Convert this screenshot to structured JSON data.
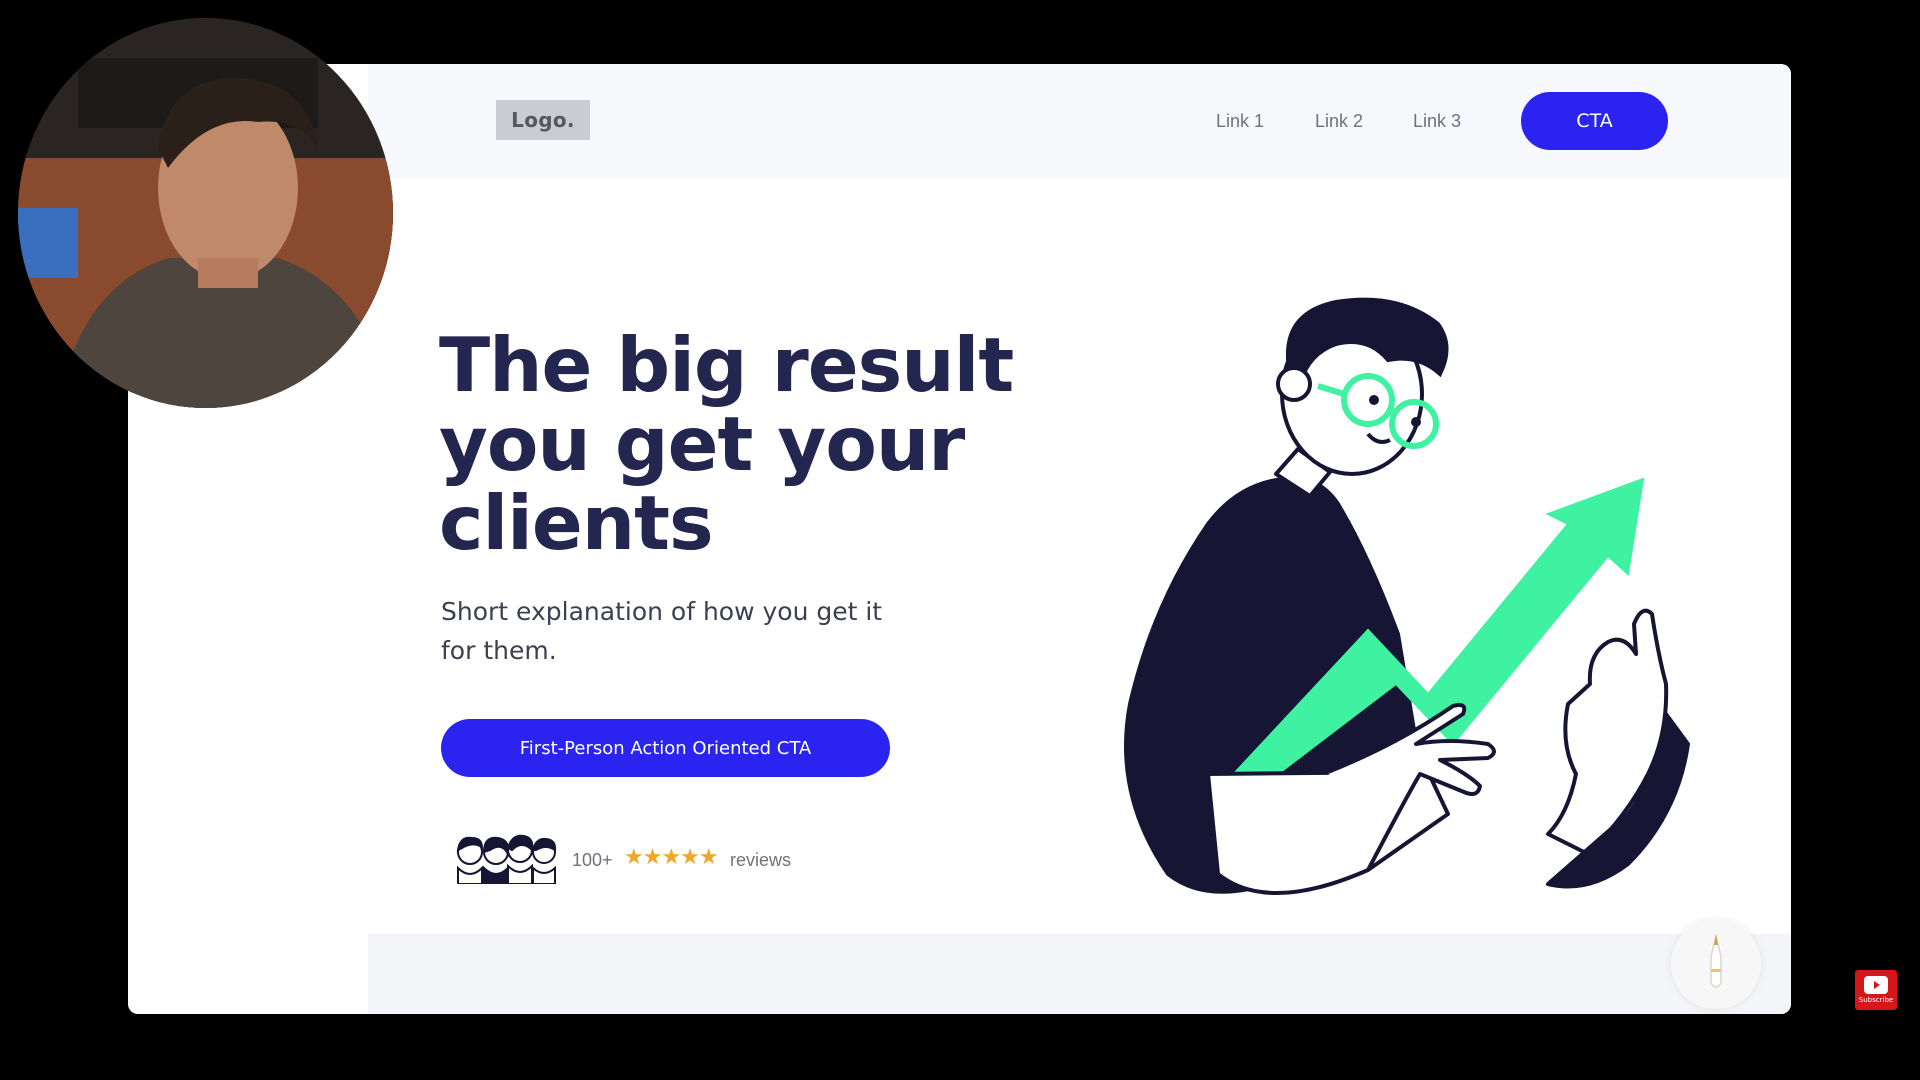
{
  "header": {
    "logo_text": "Logo.",
    "nav_links": [
      "Link 1",
      "Link 2",
      "Link 3"
    ],
    "cta_label": "CTA"
  },
  "hero": {
    "title": "The big result you get your clients",
    "subtitle": "Short explanation of how you get it for them.",
    "cta_label": "First-Person Action Oriented CTA"
  },
  "reviews": {
    "count_text": "100+",
    "stars": "★★★★★",
    "label": "reviews",
    "rating": 5
  },
  "overlay": {
    "subscribe_label": "Subscribe"
  },
  "colors": {
    "accent_blue": "#2b24f0",
    "heading_navy": "#23264f",
    "illustration_green": "#3ef2a1",
    "illustration_dark": "#161533",
    "star_gold": "#f0a72d"
  },
  "icons": [
    "user-avatars-icon",
    "star-icon",
    "pen-icon",
    "youtube-icon"
  ]
}
